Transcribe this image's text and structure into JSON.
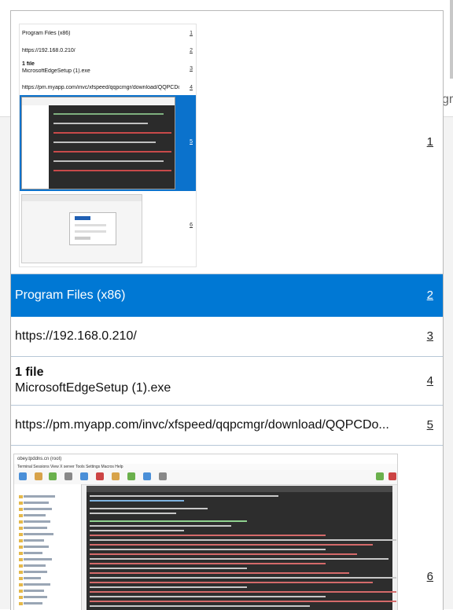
{
  "background": {
    "peek_text": "gr"
  },
  "items": [
    {
      "num": "1",
      "type": "image",
      "preview": {
        "rows": [
          {
            "text": "Program Files (x86)",
            "num": "1"
          },
          {
            "text": "https://192.168.0.210/",
            "num": "2"
          },
          {
            "title": "1 file",
            "text": "MicrosoftEdgeSetup (1).exe",
            "num": "3"
          },
          {
            "text": "https://pm.myapp.com/invc/xfspeed/qqpcmgr/download/QQPCDo...",
            "num": "4"
          },
          {
            "num": "5"
          },
          {
            "num": "6"
          }
        ]
      }
    },
    {
      "num": "2",
      "text": "Program Files (x86)",
      "selected": true
    },
    {
      "num": "3",
      "text": "https://192.168.0.210/"
    },
    {
      "num": "4",
      "title": "1 file",
      "text": "MicrosoftEdgeSetup (1).exe"
    },
    {
      "num": "5",
      "text": "https://pm.myapp.com/invc/xfspeed/qqpcmgr/download/QQPCDo..."
    },
    {
      "num": "6",
      "type": "image",
      "screenshot": {
        "window_title": "obey.tpddns.cn (root)",
        "menu": "Terminal   Sessions   View   X server   Tools   Settings   Macros   Help"
      }
    }
  ],
  "colors": {
    "selected": "#0078d4",
    "divider": "#b7c7d7"
  }
}
